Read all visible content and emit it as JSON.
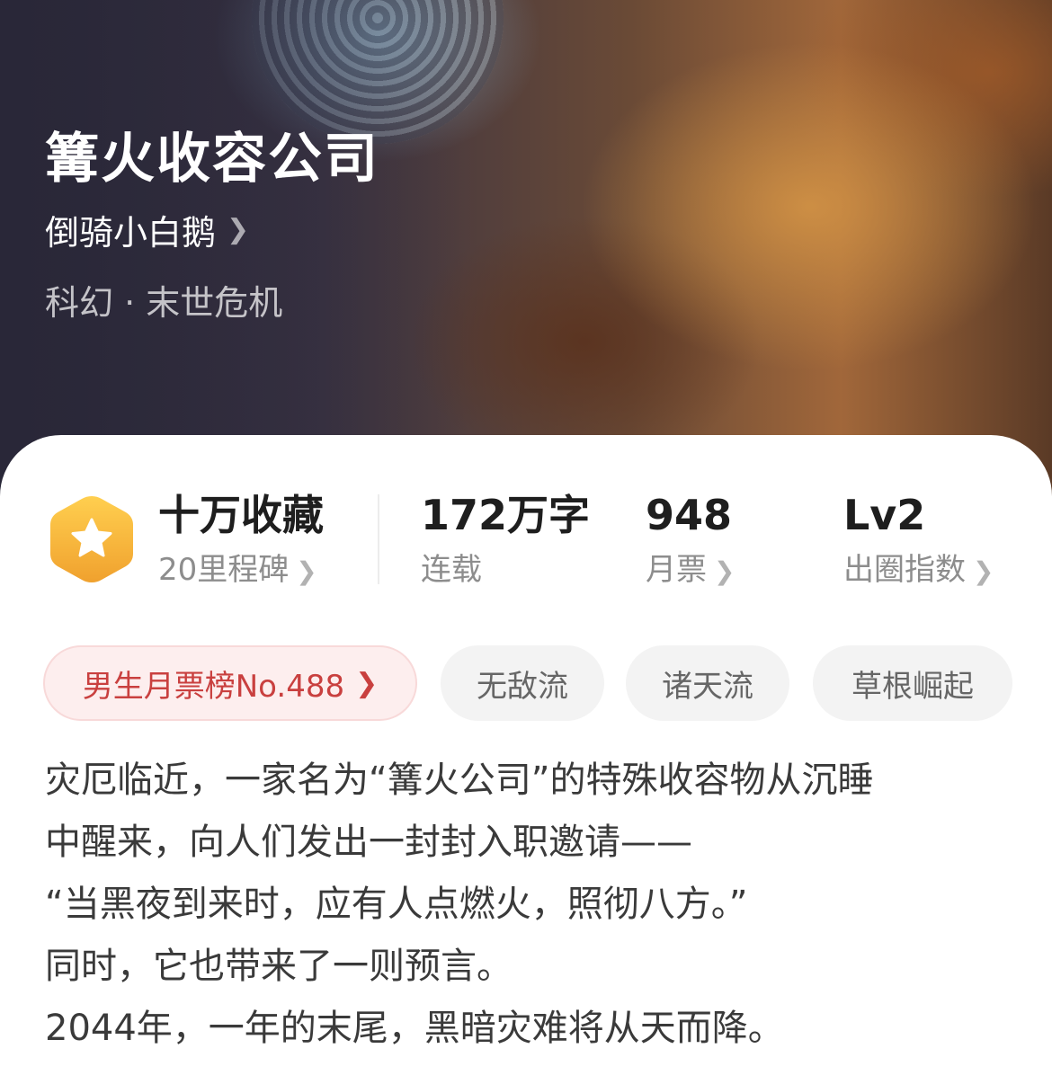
{
  "book": {
    "title": "篝火收容公司",
    "author": "倒骑小白鹅",
    "genre": "科幻 · 末世危机"
  },
  "stats": [
    {
      "value": "十万收藏",
      "label": "20里程碑"
    },
    {
      "value": "172万字",
      "label": "连载"
    },
    {
      "value": "948",
      "label": "月票"
    },
    {
      "value": "Lv2",
      "label": "出圈指数"
    }
  ],
  "tags": {
    "rank": "男生月票榜No.488",
    "items": [
      "无敌流",
      "诸天流",
      "草根崛起"
    ]
  },
  "synopsis": [
    "灾厄临近，一家名为“篝火公司”的特殊收容物从沉睡",
    "中醒来，向人们发出一封封入职邀请——",
    "“当黑夜到来时，应有人点燃火，照彻八方。”",
    "同时，它也带来了一则预言。",
    "2044年，一年的末尾，黑暗灾难将从天而降。"
  ],
  "icons": {
    "chevron": "chevron-right-icon",
    "badge": "star-badge-icon"
  },
  "colors": {
    "badge_gold": "#f5b73c",
    "rank_text": "#c9403f",
    "rank_bg": "#fdeeee"
  }
}
